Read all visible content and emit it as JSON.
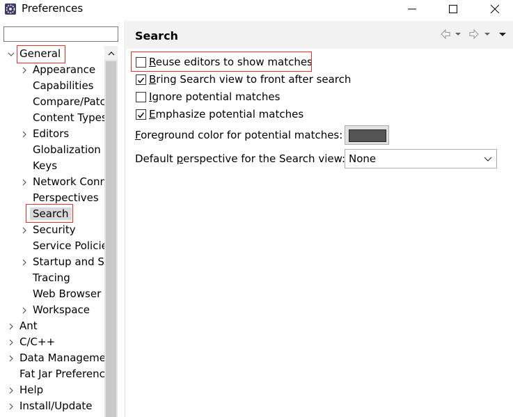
{
  "window": {
    "title": "Preferences",
    "controls": {
      "minimize_icon": "minimize-icon",
      "maximize_icon": "maximize-icon",
      "close_icon": "close-icon"
    }
  },
  "filter": {
    "value": "",
    "placeholder": ""
  },
  "tree": {
    "items": [
      {
        "label": "General",
        "level": 0,
        "expander": "expanded",
        "selected": false
      },
      {
        "label": "Appearance",
        "level": 1,
        "expander": "collapsed",
        "selected": false
      },
      {
        "label": "Capabilities",
        "level": 1,
        "expander": "none",
        "selected": false
      },
      {
        "label": "Compare/Patc",
        "level": 1,
        "expander": "none",
        "selected": false
      },
      {
        "label": "Content Types",
        "level": 1,
        "expander": "none",
        "selected": false
      },
      {
        "label": "Editors",
        "level": 1,
        "expander": "collapsed",
        "selected": false
      },
      {
        "label": "Globalization",
        "level": 1,
        "expander": "none",
        "selected": false
      },
      {
        "label": "Keys",
        "level": 1,
        "expander": "none",
        "selected": false
      },
      {
        "label": "Network Conn",
        "level": 1,
        "expander": "collapsed",
        "selected": false
      },
      {
        "label": "Perspectives",
        "level": 1,
        "expander": "none",
        "selected": false
      },
      {
        "label": "Search",
        "level": 1,
        "expander": "none",
        "selected": true
      },
      {
        "label": "Security",
        "level": 1,
        "expander": "collapsed",
        "selected": false
      },
      {
        "label": "Service Policie",
        "level": 1,
        "expander": "none",
        "selected": false
      },
      {
        "label": "Startup and Sh",
        "level": 1,
        "expander": "collapsed",
        "selected": false
      },
      {
        "label": "Tracing",
        "level": 1,
        "expander": "none",
        "selected": false
      },
      {
        "label": "Web Browser",
        "level": 1,
        "expander": "none",
        "selected": false
      },
      {
        "label": "Workspace",
        "level": 1,
        "expander": "collapsed",
        "selected": false
      },
      {
        "label": "Ant",
        "level": 0,
        "expander": "collapsed",
        "selected": false
      },
      {
        "label": "C/C++",
        "level": 0,
        "expander": "collapsed",
        "selected": false
      },
      {
        "label": "Data Managemen",
        "level": 0,
        "expander": "collapsed",
        "selected": false
      },
      {
        "label": "Fat Jar Preferenc",
        "level": 0,
        "expander": "none",
        "selected": false
      },
      {
        "label": "Help",
        "level": 0,
        "expander": "collapsed",
        "selected": false
      },
      {
        "label": "Install/Update",
        "level": 0,
        "expander": "collapsed",
        "selected": false
      }
    ]
  },
  "page": {
    "title": "Search",
    "nav_icons": [
      "back-arrow-icon",
      "back-dropdown-icon",
      "forward-arrow-icon",
      "forward-dropdown-icon",
      "view-menu-icon"
    ]
  },
  "options": {
    "reuse_editors": {
      "mn": "R",
      "rest": "euse editors to show matches",
      "checked": false
    },
    "bring_to_front": {
      "mn": "B",
      "rest": "ring Search view to front after search",
      "checked": true
    },
    "ignore_potential": {
      "mn": "I",
      "rest": "gnore potential matches",
      "checked": false
    },
    "emphasize_potential": {
      "mn": "E",
      "rest": "mphasize potential matches",
      "checked": true
    }
  },
  "foreground": {
    "mn": "F",
    "rest": "oreground color for potential matches:",
    "color": "#555555"
  },
  "perspective": {
    "pre": "Default ",
    "mn": "p",
    "rest": "erspective for the Search view:",
    "value": "None"
  },
  "colors": {
    "highlight": "#e03030",
    "selection": "#d9d9d9",
    "header": "#f2f2f2"
  }
}
